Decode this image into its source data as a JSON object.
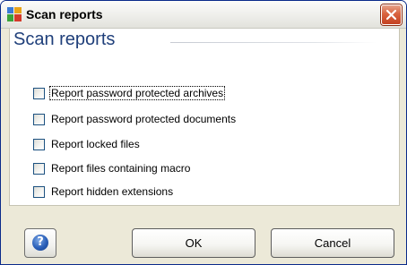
{
  "window": {
    "title": "Scan reports",
    "icon": "avg-logo-icon",
    "close_icon": "close-icon"
  },
  "section": {
    "title": "Scan reports"
  },
  "options": [
    {
      "label": "Report password protected archives",
      "checked": false,
      "focused": true
    },
    {
      "label": "Report password protected documents",
      "checked": false,
      "focused": false
    },
    {
      "label": "Report locked files",
      "checked": false,
      "focused": false
    },
    {
      "label": "Report files containing macro",
      "checked": false,
      "focused": false
    },
    {
      "label": "Report hidden extensions",
      "checked": false,
      "focused": false
    }
  ],
  "buttons": {
    "help_glyph": "?",
    "ok": "OK",
    "cancel": "Cancel"
  },
  "colors": {
    "section_title": "#1f3f7a",
    "close_button": "#d9633f",
    "dialog_background": "#ece9d8"
  }
}
